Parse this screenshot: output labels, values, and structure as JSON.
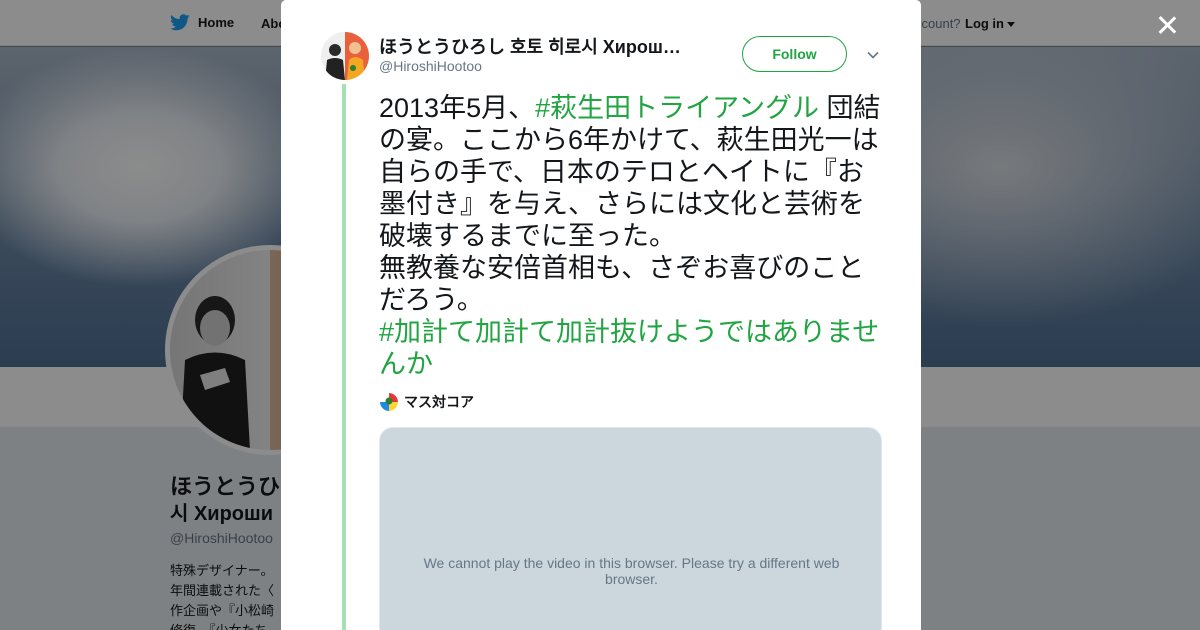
{
  "nav": {
    "home_label": "Home",
    "about_label": "Abo",
    "account_prompt": "ccount?",
    "login_label": "Log in"
  },
  "profile": {
    "name_line1": "ほうとうひ",
    "name_line2": "시 Хироши",
    "handle": "@HiroshiHootoo",
    "bio_lines": [
      "特殊デザイナー。",
      "年間連載された〈",
      "作企画や『小松崎",
      "修復、『少女たち"
    ]
  },
  "tweet": {
    "author_name": "ほうとうひろし 호토 히로시 Хирош…",
    "author_handle": "@HiroshiHootoo",
    "follow_label": "Follow",
    "text_line1_pre": "2013年5月、",
    "hashtag1": "#萩生田トライアングル",
    "text_line1_post": " 団結の宴。ここから6年かけて、萩生田光一は自らの手で、日本のテロとヘイトに『お墨付き』を与え、さらには文化と芸術を破壊するまでに至った。",
    "text_line2": "無教養な安倍首相も、さぞお喜びのことだろう。",
    "hashtag2": "#加計て加計て加計抜けようではありませんか",
    "card_source": "マス対コア",
    "video_message": "We cannot play the video in this browser. Please try a different web browser."
  },
  "colors": {
    "accent": "#21a442",
    "thread_line": "#a6e0b5",
    "handle_gray": "#657786",
    "video_bg": "#ccd6dd"
  },
  "icons": {
    "logo": "bird-icon",
    "close": "close-icon",
    "menu": "chevron-down-icon"
  }
}
